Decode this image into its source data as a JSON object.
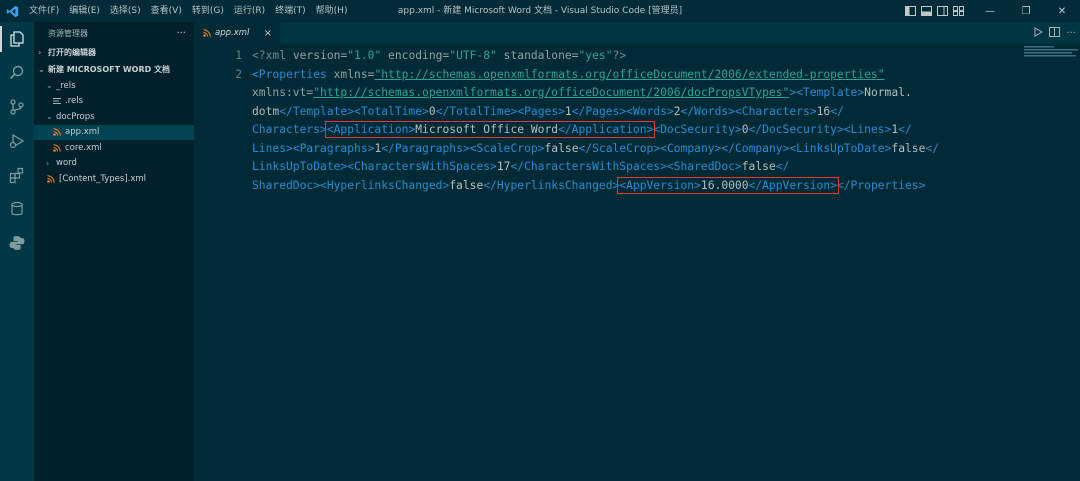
{
  "titlebar": {
    "menu": [
      "文件(F)",
      "编辑(E)",
      "选择(S)",
      "查看(V)",
      "转到(G)",
      "运行(R)",
      "终端(T)",
      "帮助(H)"
    ],
    "window_title": "app.xml - 新建 Microsoft Word 文档 - Visual Studio Code [管理员]",
    "controls": {
      "minimize": "—",
      "maximize": "❐",
      "close": "✕"
    }
  },
  "sidebar": {
    "title": "资源管理器",
    "more": "···",
    "open_editors": "打开的编辑器",
    "root_folder": "新建 MICROSOFT WORD 文档",
    "tree": {
      "rels_folder": "_rels",
      "rels_file": ".rels",
      "docprops_folder": "docProps",
      "app_xml": "app.xml",
      "core_xml": "core.xml",
      "word_folder": "word",
      "content_types": "[Content_Types].xml"
    }
  },
  "editor": {
    "tab_label": "app.xml",
    "line_numbers": [
      "1",
      "2"
    ],
    "line1": {
      "decl_open": "<?xml",
      "version_attr": " version=",
      "version_val": "\"1.0\"",
      "encoding_attr": " encoding=",
      "encoding_val": "\"UTF-8\"",
      "standalone_attr": " standalone=",
      "standalone_val": "\"yes\"",
      "decl_close": "?>"
    },
    "line2": {
      "props_open": "<Properties",
      "xmlns_attr": " xmlns=",
      "xmlns_val": "\"http://schemas.openxmlformats.org/officeDocument/2006/extended-properties\"",
      "xmlnsvt_attr": "xmlns:vt=",
      "xmlnsvt_val": "\"http://schemas.openxmlformats.org/officeDocument/2006/docPropsVTypes\"",
      "gt": ">",
      "template_open": "<Template>",
      "template_val_part1": "Normal.",
      "template_val_part2": "dotm",
      "template_close": "</Template>",
      "totaltime_open": "<TotalTime>",
      "totaltime_val": "0",
      "totaltime_close": "</TotalTime>",
      "pages_open": "<Pages>",
      "pages_val": "1",
      "pages_close": "</Pages>",
      "words_open": "<Words>",
      "words_val": "2",
      "words_close": "</Words>",
      "characters_open": "<Characters>",
      "characters_val": "16",
      "characters_close_part1": "</",
      "characters_close_part2": "Characters>",
      "application_open": "<Application>",
      "application_val": "Microsoft Office Word",
      "application_close": "</Application>",
      "docsecurity_open": "<DocSecurity>",
      "docsecurity_val": "0",
      "docsecurity_close": "</DocSecurity>",
      "lines_open": "<Lines>",
      "lines_val": "1",
      "lines_close_part1": "</",
      "lines_close_part2": "Lines>",
      "paragraphs_open": "<Paragraphs>",
      "paragraphs_val": "1",
      "paragraphs_close": "</Paragraphs>",
      "scalecrop_open": "<ScaleCrop>",
      "scalecrop_val": "false",
      "scalecrop_close": "</ScaleCrop>",
      "company_open": "<Company>",
      "company_close": "</Company>",
      "linksuptodate_open": "<LinksUpToDate>",
      "linksuptodate_val": "false",
      "linksuptodate_close_part1": "</",
      "linksuptodate_close_part2": "LinksUpToDate>",
      "cws_open": "<CharactersWithSpaces>",
      "cws_val": "17",
      "cws_close": "</CharactersWithSpaces>",
      "shareddoc_open": "<SharedDoc>",
      "shareddoc_val": "false",
      "shareddoc_close_part1": "</",
      "shareddoc_close_part2": "SharedDoc>",
      "hyperlinks_open": "<HyperlinksChanged>",
      "hyperlinks_val": "false",
      "hyperlinks_close": "</HyperlinksChanged>",
      "appversion_open": "<AppVersion>",
      "appversion_val": "16.0000",
      "appversion_close": "</AppVersion>",
      "props_close": "</Properties>"
    }
  }
}
